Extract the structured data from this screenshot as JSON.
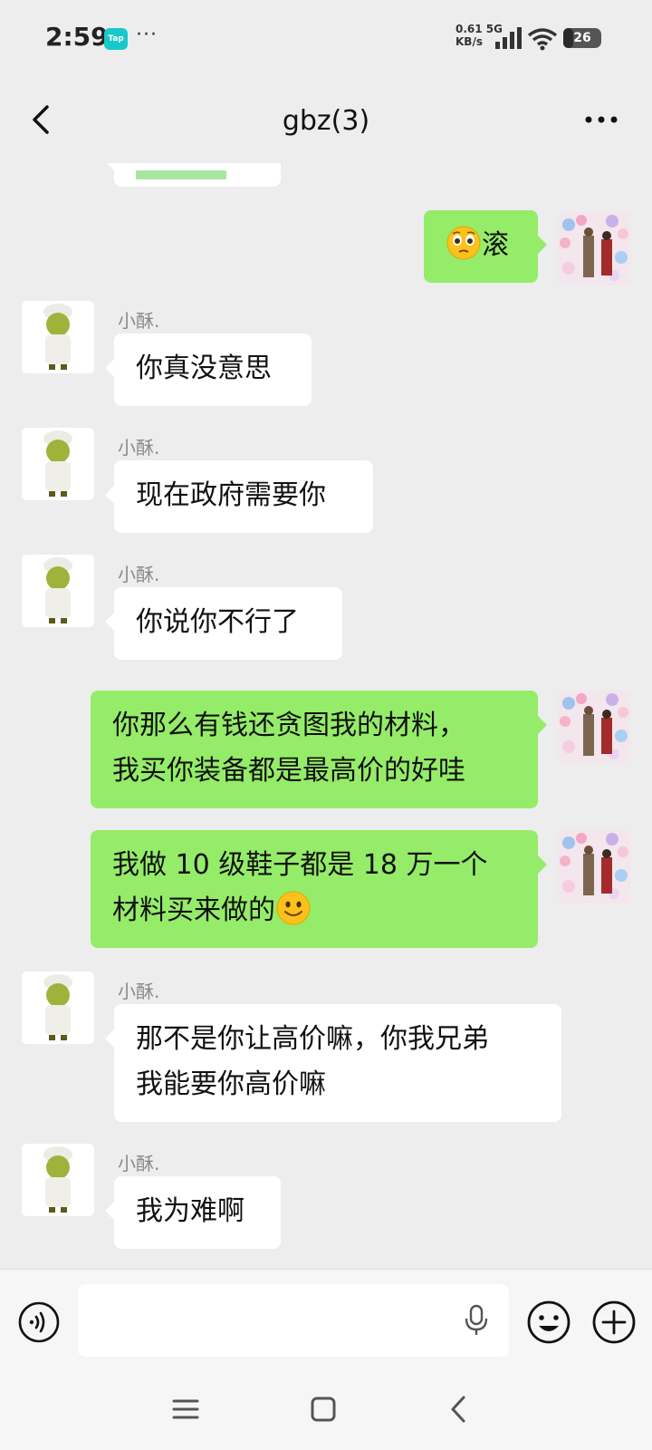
{
  "status_bar": {
    "time": "2:59",
    "app_badge": "Tap",
    "more_dots": "···",
    "net_speed_value": "0.61 5G",
    "net_speed_unit": "KB/s",
    "battery_level": "26"
  },
  "header": {
    "title": "gbz(3)"
  },
  "messages": [
    {
      "direction": "in",
      "partial": true
    },
    {
      "direction": "out",
      "text": "滚",
      "emoji_prefix": "pleading-face"
    },
    {
      "direction": "in",
      "sender": "小酥.",
      "text": "你真没意思"
    },
    {
      "direction": "in",
      "sender": "小酥.",
      "text": "现在政府需要你"
    },
    {
      "direction": "in",
      "sender": "小酥.",
      "text": "你说你不行了"
    },
    {
      "direction": "out",
      "lines": [
        "你那么有钱还贪图我的材料，",
        "我买你装备都是最高价的好哇"
      ]
    },
    {
      "direction": "out",
      "lines": [
        "我做 10 级鞋子都是 18 万一个",
        "材料买来做的"
      ],
      "emoji_suffix": "smiling-face"
    },
    {
      "direction": "in",
      "sender": "小酥.",
      "lines": [
        "那不是你让高价嘛，你我兄弟",
        "我能要你高价嘛"
      ]
    },
    {
      "direction": "in",
      "sender": "小酥.",
      "text": "我为难啊"
    }
  ],
  "input_bar": {
    "value": "",
    "placeholder": ""
  },
  "colors": {
    "background": "#ededed",
    "bubble_out": "#95ec69",
    "bubble_in": "#ffffff"
  }
}
